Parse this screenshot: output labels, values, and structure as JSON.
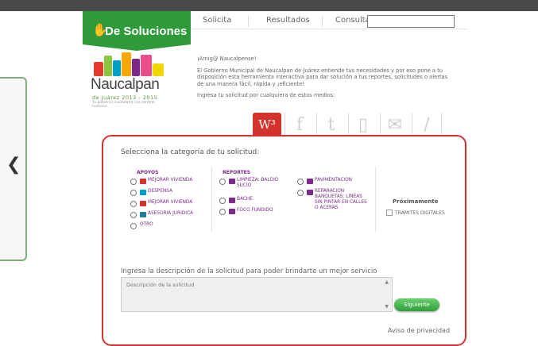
{
  "header": {
    "brand": "De Soluciones"
  },
  "nav": {
    "items": [
      "Solicita",
      "Resultados",
      "Consulta"
    ],
    "search_value": ""
  },
  "logo": {
    "name": "Naucalpan",
    "sub": "de Juárez 2013 - 2015",
    "tag": "Tu gobierno cuidadano con sentido humano"
  },
  "intro": {
    "greeting": "¡Amig@ Naucalpense!",
    "body": "El Gobierno Municipal de Naucalpan de Juárez entiende tus necesidades y por eso pone a tu disposición esta herramienta interactiva para dar solución a tus reportes, solicitudes o alertas de una manera fácil, rápida y ¡eficiente!",
    "channels_prompt": "Ingresa tu solicitud por cualquiera de estos medios:"
  },
  "channels": [
    "W³",
    "f",
    "t",
    "▯",
    "✉",
    "/"
  ],
  "form": {
    "title": "Selecciona la categoría de tu solicitud:",
    "apoyos_header": "APOYOS",
    "apoyos": [
      "MEJORAR VIVIENDA",
      "DESPENSA",
      "MEJORAR VIVIENDA",
      "ASESORIA JURIDICA",
      "OTRO"
    ],
    "reportes_header": "REPORTES",
    "reportes_a": [
      "LIMPIEZA: BALDIO SUCIO",
      "BACHE",
      "FOCO FUNDIDO"
    ],
    "reportes_b": [
      "PAVIMENTACION",
      "REPARACION BANQUETAS: LÍNEAS SIN PINTAR EN CALLES O ACERAS"
    ],
    "proximamente": "Próximamente",
    "tramites": "TRÁMITES DIGITALES",
    "desc_label": "Ingresa la descripción de la solicitud para poder brindarte un mejor servicio",
    "desc_placeholder": "Descripción de la solicitud",
    "next_button": "Siguiente",
    "privacy": "Aviso de privacidad"
  },
  "colors": {
    "brand_green": "#2f9a3a",
    "accent_red": "#d4322c",
    "purple": "#7c2a8a"
  }
}
